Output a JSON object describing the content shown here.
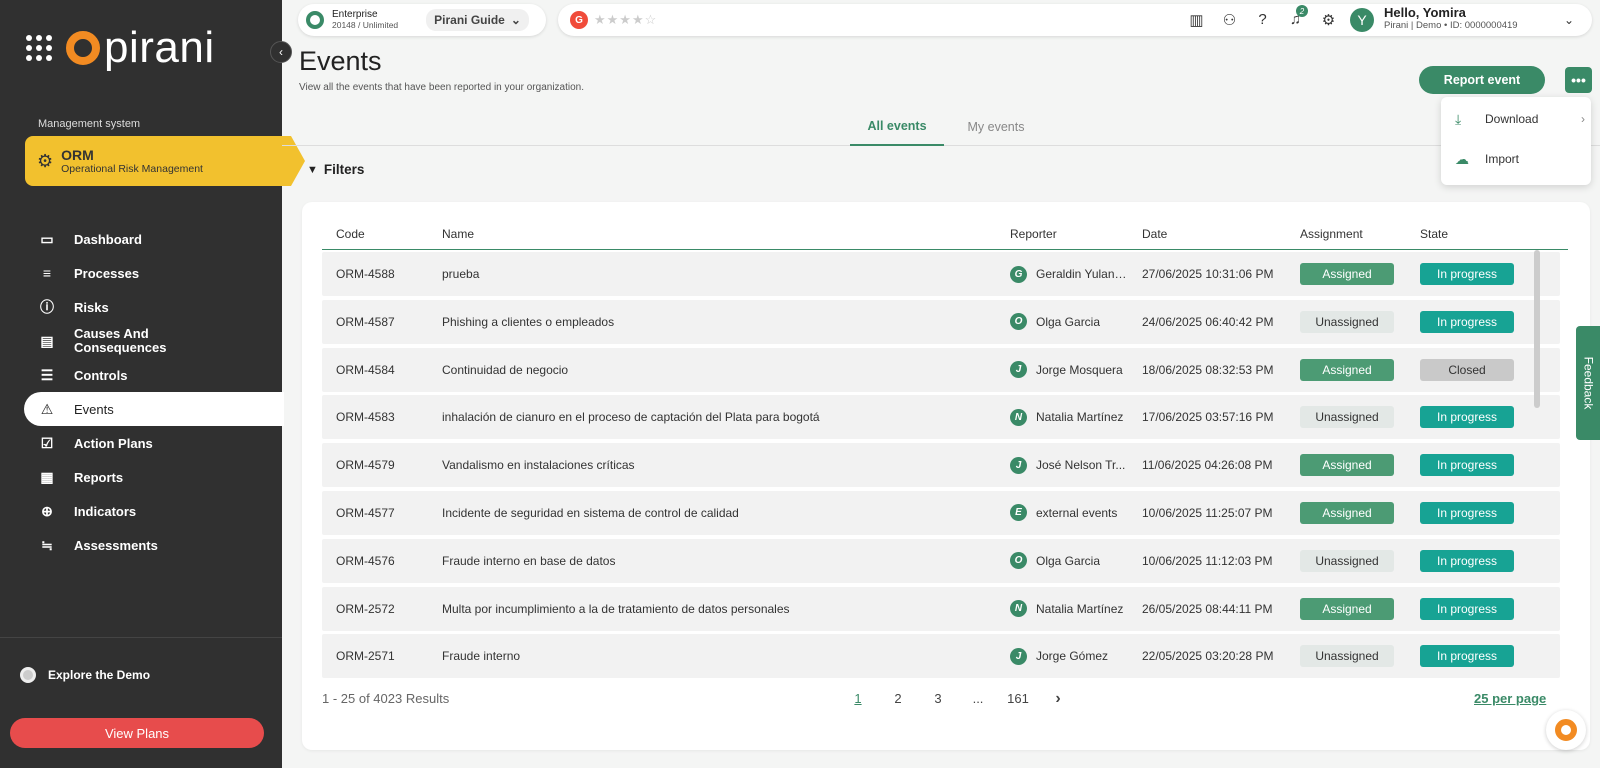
{
  "brand": {
    "name": "pirani"
  },
  "sidebar": {
    "mgmt_label": "Management system",
    "module": {
      "title": "ORM",
      "subtitle": "Operational Risk Management"
    },
    "items": [
      {
        "label": "Dashboard",
        "icon": "monitor-icon"
      },
      {
        "label": "Processes",
        "icon": "list-icon"
      },
      {
        "label": "Risks",
        "icon": "alert-circle-icon"
      },
      {
        "label": "Causes And Consequences",
        "icon": "cause-icon"
      },
      {
        "label": "Controls",
        "icon": "sliders-icon"
      },
      {
        "label": "Events",
        "icon": "warning-triangle-icon"
      },
      {
        "label": "Action Plans",
        "icon": "checkbox-icon"
      },
      {
        "label": "Reports",
        "icon": "bar-chart-icon"
      },
      {
        "label": "Indicators",
        "icon": "target-icon"
      },
      {
        "label": "Assessments",
        "icon": "assessment-icon"
      }
    ],
    "explore": "Explore the Demo",
    "view_plans": "View Plans"
  },
  "topbar": {
    "plan": "Enterprise",
    "plan_usage": "20148 / Unlimited",
    "guide": "Pirani Guide",
    "g2": "G",
    "rating_stars": "★★★★☆",
    "notifications": "2",
    "user_initial": "Y",
    "hello": "Hello, Yomira",
    "user_sub": "Pirani | Demo • ID: 0000000419"
  },
  "page": {
    "title": "Events",
    "subtitle": "View all the events that have been reported in your organization.",
    "report_button": "Report event",
    "more_button": "•••",
    "tabs": [
      "All events",
      "My events"
    ],
    "filters": "Filters"
  },
  "menu": {
    "download": "Download",
    "import": "Import"
  },
  "table": {
    "headers": {
      "code": "Code",
      "name": "Name",
      "reporter": "Reporter",
      "date": "Date",
      "assignment": "Assignment",
      "state": "State"
    },
    "rows": [
      {
        "code": "ORM-4588",
        "name": "prueba",
        "initial": "G",
        "reporter": "Geraldin Yulani ...",
        "date": "27/06/2025 10:31:06 PM",
        "assignment": "Assigned",
        "state": "In progress"
      },
      {
        "code": "ORM-4587",
        "name": "Phishing a clientes o empleados",
        "initial": "O",
        "reporter": "Olga Garcia",
        "date": "24/06/2025 06:40:42 PM",
        "assignment": "Unassigned",
        "state": "In progress"
      },
      {
        "code": "ORM-4584",
        "name": "Continuidad de negocio",
        "initial": "J",
        "reporter": "Jorge Mosquera",
        "date": "18/06/2025 08:32:53 PM",
        "assignment": "Assigned",
        "state": "Closed"
      },
      {
        "code": "ORM-4583",
        "name": "inhalación de cianuro en el proceso de captación del Plata para bogotá",
        "initial": "N",
        "reporter": "Natalia Martínez",
        "date": "17/06/2025 03:57:16 PM",
        "assignment": "Unassigned",
        "state": "In progress"
      },
      {
        "code": "ORM-4579",
        "name": "Vandalismo en instalaciones críticas",
        "initial": "J",
        "reporter": "José Nelson Tr...",
        "date": "11/06/2025 04:26:08 PM",
        "assignment": "Assigned",
        "state": "In progress"
      },
      {
        "code": "ORM-4577",
        "name": "Incidente de seguridad en sistema de control de calidad",
        "initial": "E",
        "reporter": "external events",
        "date": "10/06/2025 11:25:07 PM",
        "assignment": "Assigned",
        "state": "In progress"
      },
      {
        "code": "ORM-4576",
        "name": "Fraude interno en base de datos",
        "initial": "O",
        "reporter": "Olga Garcia",
        "date": "10/06/2025 11:12:03 PM",
        "assignment": "Unassigned",
        "state": "In progress"
      },
      {
        "code": "ORM-2572",
        "name": "Multa por incumplimiento a la de tratamiento de datos personales",
        "initial": "N",
        "reporter": "Natalia Martínez",
        "date": "26/05/2025 08:44:11 PM",
        "assignment": "Assigned",
        "state": "In progress"
      },
      {
        "code": "ORM-2571",
        "name": "Fraude interno",
        "initial": "J",
        "reporter": "Jorge Gómez",
        "date": "22/05/2025 03:20:28 PM",
        "assignment": "Unassigned",
        "state": "In progress"
      }
    ]
  },
  "pagination": {
    "info": "1 - 25 of 4023 Results",
    "pages": [
      "1",
      "2",
      "3",
      "...",
      "161"
    ],
    "next": "›",
    "per_page": "25 per page"
  },
  "feedback": "Feedback",
  "colors": {
    "primary": "#3a8a67",
    "sidebar": "#303030",
    "module": "#f2c12e",
    "danger": "#e74c4c",
    "teal": "#17a394"
  }
}
